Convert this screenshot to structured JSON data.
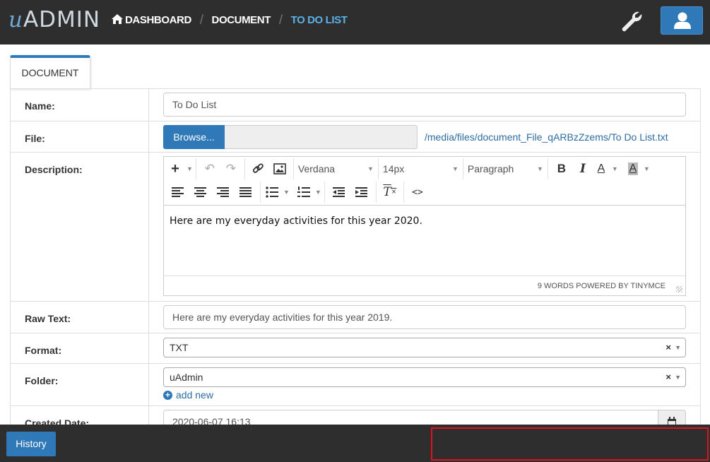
{
  "brand": {
    "logo_u": "u",
    "logo_rest": "ADMIN"
  },
  "breadcrumb": {
    "items": [
      "DASHBOARD",
      "DOCUMENT",
      "TO DO LIST"
    ]
  },
  "tab": {
    "label": "DOCUMENT"
  },
  "form": {
    "name": {
      "label": "Name:",
      "value": "To Do List"
    },
    "file": {
      "label": "File:",
      "browse": "Browse...",
      "link": "/media/files/document_File_qARBzZzems/To Do List.txt"
    },
    "description": {
      "label": "Description:",
      "font": "Verdana",
      "size": "14px",
      "block": "Paragraph",
      "content": "Here are my everyday activities for this year 2020.",
      "status": "9 WORDS POWERED BY TINYMCE"
    },
    "raw_text": {
      "label": "Raw Text:",
      "value": "Here are my everyday activities for this year 2019."
    },
    "format": {
      "label": "Format:",
      "value": "TXT"
    },
    "folder": {
      "label": "Folder:",
      "value": "uAdmin",
      "add_new": "add new"
    },
    "created_date": {
      "label": "Created Date:",
      "value": "2020-06-07 16:13"
    }
  },
  "footer": {
    "history": "History"
  },
  "colors": {
    "accent": "#2f79b9",
    "topbar": "#2e2e2e",
    "active_crumb": "#5bb2ea",
    "highlight": "#e0121d"
  },
  "icons": [
    "home-icon",
    "wrench-icon",
    "user-icon",
    "calendar-icon",
    "plus-circle-icon"
  ]
}
